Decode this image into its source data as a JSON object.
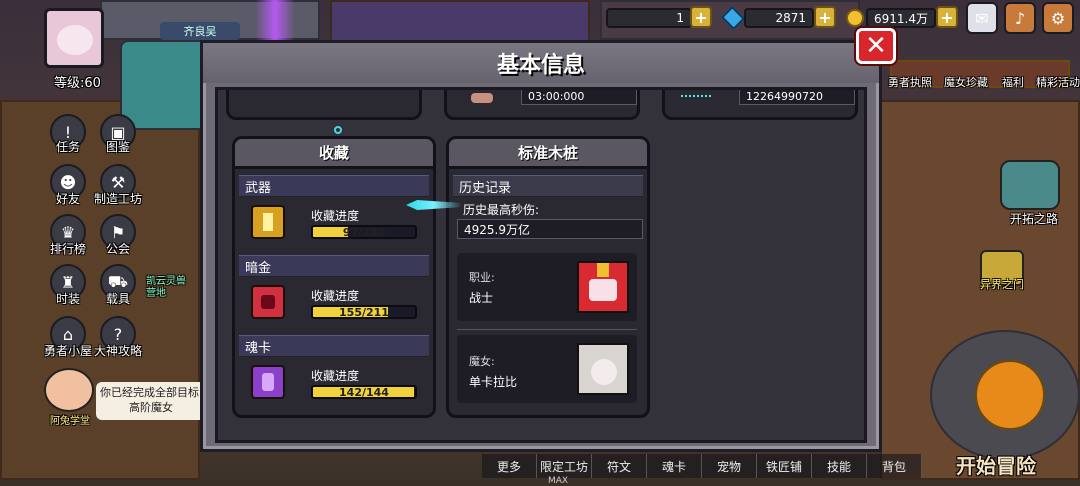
{
  "hud": {
    "server_name": "齐良吴",
    "level_label": "等级:60",
    "res_count_1": "1",
    "res_count_2": "2871",
    "res_count_3": "6911.4万",
    "left_menu": [
      "任务",
      "图鉴",
      "好友",
      "制造工坊",
      "排行榜",
      "公会",
      "时装",
      "载具",
      "勇者小屋",
      "大神攻略"
    ],
    "top_right_labels": [
      "勇者执照",
      "魔女珍藏",
      "福利",
      "精彩活动"
    ],
    "notice_line1": "你已经完成全部目标",
    "notice_line2": "高阶魔女",
    "notice_npc": "阿兔学堂",
    "right_route_1": "开拓之路",
    "right_route_2": "异界之门",
    "start_button": "开始冒险",
    "pet_label_line1": "凯云灵兽",
    "pet_label_line2": "营地",
    "bottom_menu": [
      "更多",
      "限定工坊",
      "符文",
      "魂卡",
      "宠物",
      "铁匠铺",
      "技能",
      "背包"
    ],
    "bottom_max": "MAX"
  },
  "modal": {
    "title": "基本信息",
    "top_values": [
      "03:00:000",
      "12264990720"
    ],
    "collection": {
      "title": "收藏",
      "sections": [
        {
          "name": "武器",
          "progress_label": "收藏进度",
          "text": "97/280",
          "fraction": 0.346,
          "color": "#d8a020"
        },
        {
          "name": "暗金",
          "progress_label": "收藏进度",
          "text": "155/211",
          "fraction": 0.735,
          "color": "#d03040"
        },
        {
          "name": "魂卡",
          "progress_label": "收藏进度",
          "text": "142/144",
          "fraction": 0.986,
          "color": "#8a40c8"
        }
      ]
    },
    "dummy": {
      "title": "标准木桩",
      "history_header": "历史记录",
      "max_dps_label": "历史最高秒伤:",
      "max_dps_value": "4925.9万亿",
      "class_label": "职业:",
      "class_value": "战士",
      "witch_label": "魔女:",
      "witch_value": "单卡拉比"
    }
  },
  "colors": {
    "accent_gold": "#f2d23a",
    "close_red": "#d8262a",
    "section_blue": "#3a3a58"
  }
}
